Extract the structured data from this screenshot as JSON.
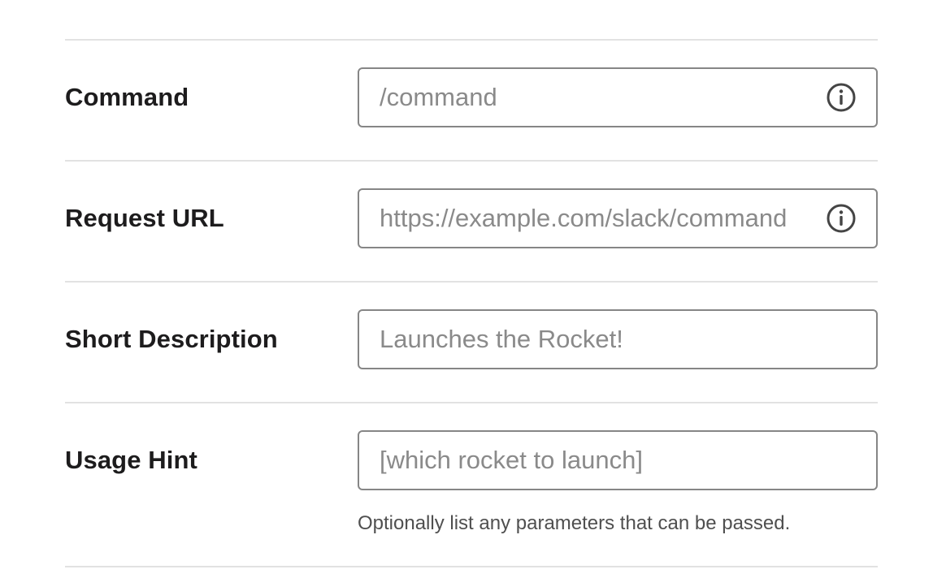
{
  "fields": [
    {
      "label": "Command",
      "placeholder": "/command",
      "value": "",
      "icon": "info-icon"
    },
    {
      "label": "Request URL",
      "placeholder": "https://example.com/slack/command",
      "value": "",
      "icon": "info-icon"
    },
    {
      "label": "Short Description",
      "placeholder": "Launches the Rocket!",
      "value": ""
    },
    {
      "label": "Usage Hint",
      "placeholder": "[which rocket to launch]",
      "value": "",
      "hint": "Optionally list any parameters that can be passed."
    }
  ],
  "colors": {
    "border": "#868686",
    "divider": "#e2e2e2",
    "placeholder": "#8a8a8a",
    "text": "#1d1c1d",
    "hint": "#4f4f4f"
  }
}
